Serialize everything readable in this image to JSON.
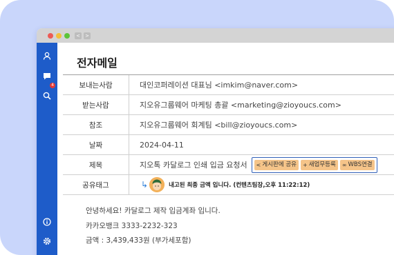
{
  "page": {
    "title": "전자메일"
  },
  "window": {
    "back_label": "<",
    "forward_label": ">"
  },
  "sidebar": {
    "badge_count": "4"
  },
  "fields": {
    "from_label": "보내는사람",
    "from_value": "대인코퍼레이션 대표님 <imkim@naver.com>",
    "to_label": "받는사람",
    "to_value": "지오유그룹웨어 마케팅 총괄 <marketing@zioyoucs.com>",
    "cc_label": "참조",
    "cc_value": "지오유그룹웨어 회계팀 <bill@zioyoucs.com>",
    "date_label": "날짜",
    "date_value": "2024-04-11",
    "subject_label": "제목",
    "subject_value": "지오톡 카달로그 인쇄 입금 요청서",
    "share_label": "공유태그",
    "share_text": "내고된 최종 금액 입니다. (컨텐츠팀장,오후 11:22:12)"
  },
  "actions": {
    "board_share": "게시판에 공유",
    "new_task": "새업무등록",
    "wbs_link": "WBS연결"
  },
  "body": {
    "line1": "안녕하세요! 카달로그 제작 입금계좌 입니다.",
    "line2": "카카오뱅크 3333-2232-323",
    "line3": "금액 : 3,439,433원 (부가세포함)"
  },
  "colors": {
    "sidebar": "#1e5cc9",
    "tag_bg": "#f5c489",
    "action_border": "#2f5fb8",
    "background_card": "#c9d6fb"
  },
  "icons": [
    "user-icon",
    "chat-icon",
    "search-icon",
    "info-icon",
    "gear-icon"
  ]
}
